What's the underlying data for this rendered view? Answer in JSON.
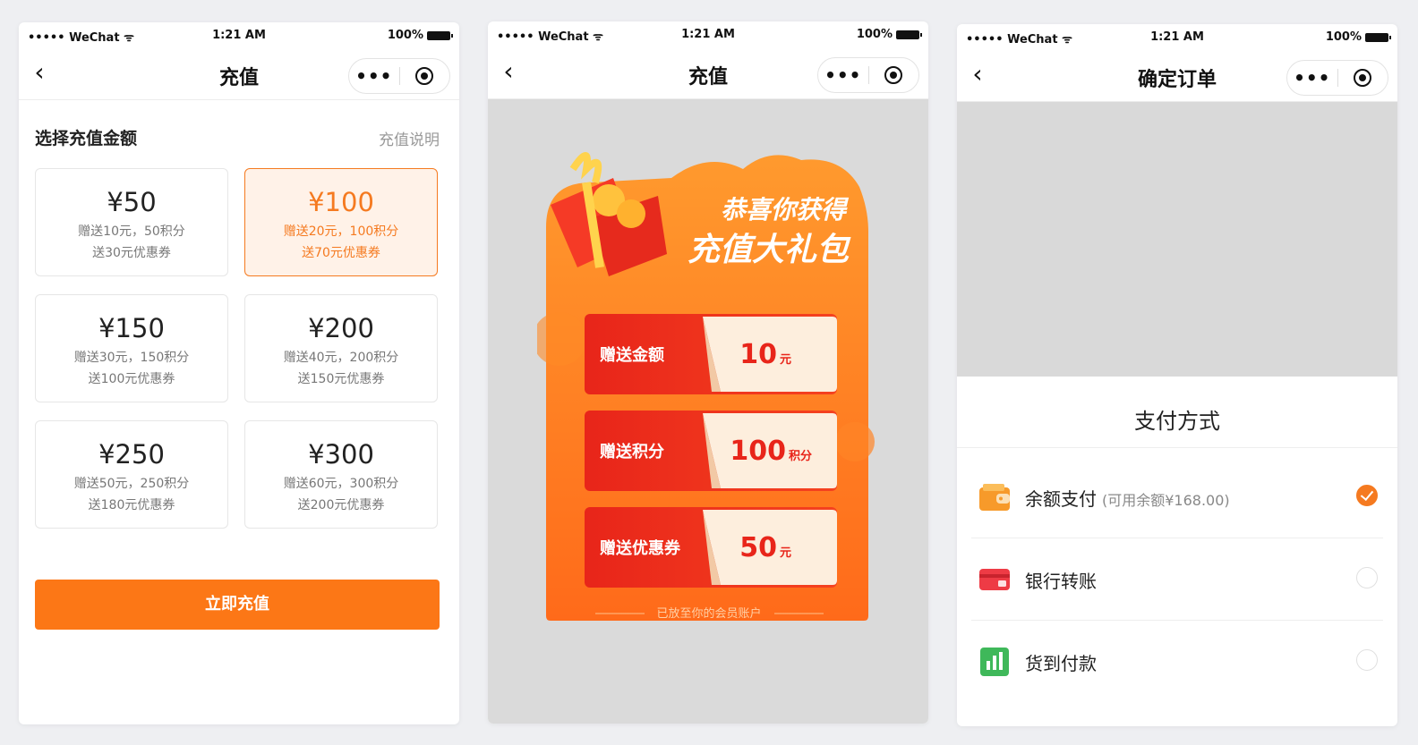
{
  "status": {
    "carrier": "••••• WeChat ᯤ",
    "time": "1:21 AM",
    "battery": "100%"
  },
  "screen1": {
    "title": "充值",
    "section_title": "选择充值金额",
    "section_link": "充值说明",
    "amounts": [
      {
        "value": "¥50",
        "line1": "赠送10元，50积分",
        "line2": "送30元优惠券",
        "selected": false
      },
      {
        "value": "¥100",
        "line1": "赠送20元，100积分",
        "line2": "送70元优惠券",
        "selected": true
      },
      {
        "value": "¥150",
        "line1": "赠送30元，150积分",
        "line2": "送100元优惠券",
        "selected": false
      },
      {
        "value": "¥200",
        "line1": "赠送40元，200积分",
        "line2": "送150元优惠券",
        "selected": false
      },
      {
        "value": "¥250",
        "line1": "赠送50元，250积分",
        "line2": "送180元优惠券",
        "selected": false
      },
      {
        "value": "¥300",
        "line1": "赠送60元，300积分",
        "line2": "送200元优惠券",
        "selected": false
      }
    ],
    "button": "立即充值"
  },
  "screen2": {
    "title": "充值",
    "headline1": "恭喜你获得",
    "headline2": "充值大礼包",
    "rewards": [
      {
        "label": "赠送金额",
        "value": "10",
        "unit": "元"
      },
      {
        "label": "赠送积分",
        "value": "100",
        "unit": "积分"
      },
      {
        "label": "赠送优惠券",
        "value": "50",
        "unit": "元"
      }
    ],
    "footer": "已放至你的会员账户"
  },
  "screen3": {
    "title": "确定订单",
    "pay_title": "支付方式",
    "methods": [
      {
        "label": "余额支付",
        "sub": "(可用余额¥168.00)",
        "icon": "wallet-icon",
        "checked": true
      },
      {
        "label": "银行转账",
        "sub": "",
        "icon": "bank-card-icon",
        "checked": false
      },
      {
        "label": "货到付款",
        "sub": "",
        "icon": "cash-on-delivery-icon",
        "checked": false
      }
    ]
  },
  "colors": {
    "accent": "#f57a20",
    "button": "#fc7716",
    "gift_red": "#f23a1f"
  }
}
